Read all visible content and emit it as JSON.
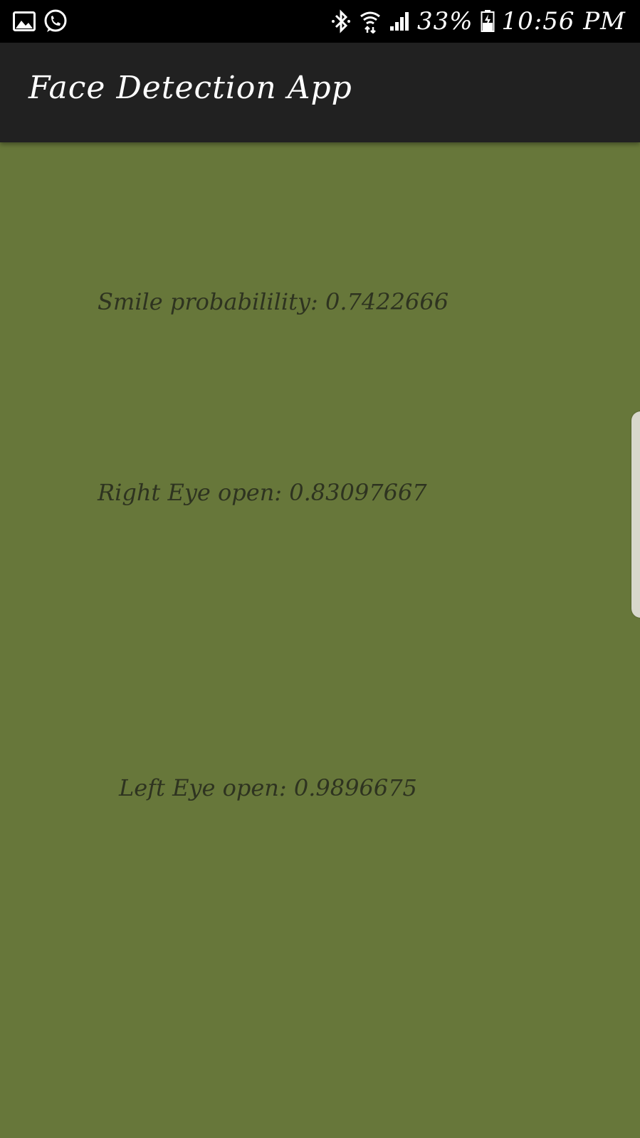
{
  "status_bar": {
    "icons_left": [
      "gallery-icon",
      "whatsapp-icon"
    ],
    "icons_right": [
      "bluetooth-icon",
      "wifi-icon",
      "signal-icon",
      "battery-charging-icon"
    ],
    "battery": "33%",
    "time": "10:56 PM"
  },
  "app_bar": {
    "title": "Face Detection App"
  },
  "results": {
    "smile": "Smile probabilility: 0.7422666",
    "right_eye": "Right Eye open: 0.83097667",
    "left_eye": "Left Eye open: 0.9896675"
  },
  "colors": {
    "background": "#67773a",
    "app_bar": "#212121",
    "status_bar": "#000000",
    "text": "#2e3320"
  }
}
